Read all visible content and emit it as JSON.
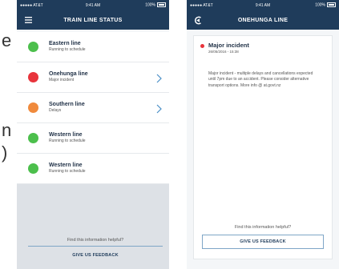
{
  "left_edge_fragments": [
    "e",
    "n",
    ")"
  ],
  "left_phone": {
    "status": {
      "carrier": "●●●●● AT&T",
      "time": "9:41 AM",
      "battery": "100%"
    },
    "title": "TRAIN LINE STATUS",
    "lines": [
      {
        "name": "Eastern line",
        "status": "Running to schedule",
        "color": "#4cbf4c",
        "chevron": false
      },
      {
        "name": "Onehunga line",
        "status": "Major incident",
        "color": "#e8343c",
        "chevron": true
      },
      {
        "name": "Southern line",
        "status": "Delays",
        "color": "#f08a3c",
        "chevron": true
      },
      {
        "name": "Western line",
        "status": "Running to schedule",
        "color": "#4cbf4c",
        "chevron": false
      },
      {
        "name": "Western line",
        "status": "Running to schedule",
        "color": "#4cbf4c",
        "chevron": false
      }
    ],
    "feedback_question": "Find this information helpful?",
    "feedback_button": "GIVE US FEEDBACK"
  },
  "right_phone": {
    "status": {
      "carrier": "●●●●● AT&T",
      "time": "9:41 AM",
      "battery": "100%"
    },
    "title": "ONEHUNGA LINE",
    "incident": {
      "title": "Major incident",
      "date": "26/05/2016 - 15:38",
      "body": "Major incident - multiple delays and cancellations expected until 7pm due to an accident. Please consider alternative transport options. More info @ at.govt.nz"
    },
    "feedback_question": "Find this information helpful?",
    "feedback_button": "GIVE US FEEDBACK"
  },
  "colors": {
    "navbar": "#1f3c5b",
    "accent_line": "#7fa6c7"
  },
  "icons": {
    "menu": "hamburger-menu-icon",
    "back": "back-arrow-icon",
    "chevron": "chevron-right-icon"
  }
}
